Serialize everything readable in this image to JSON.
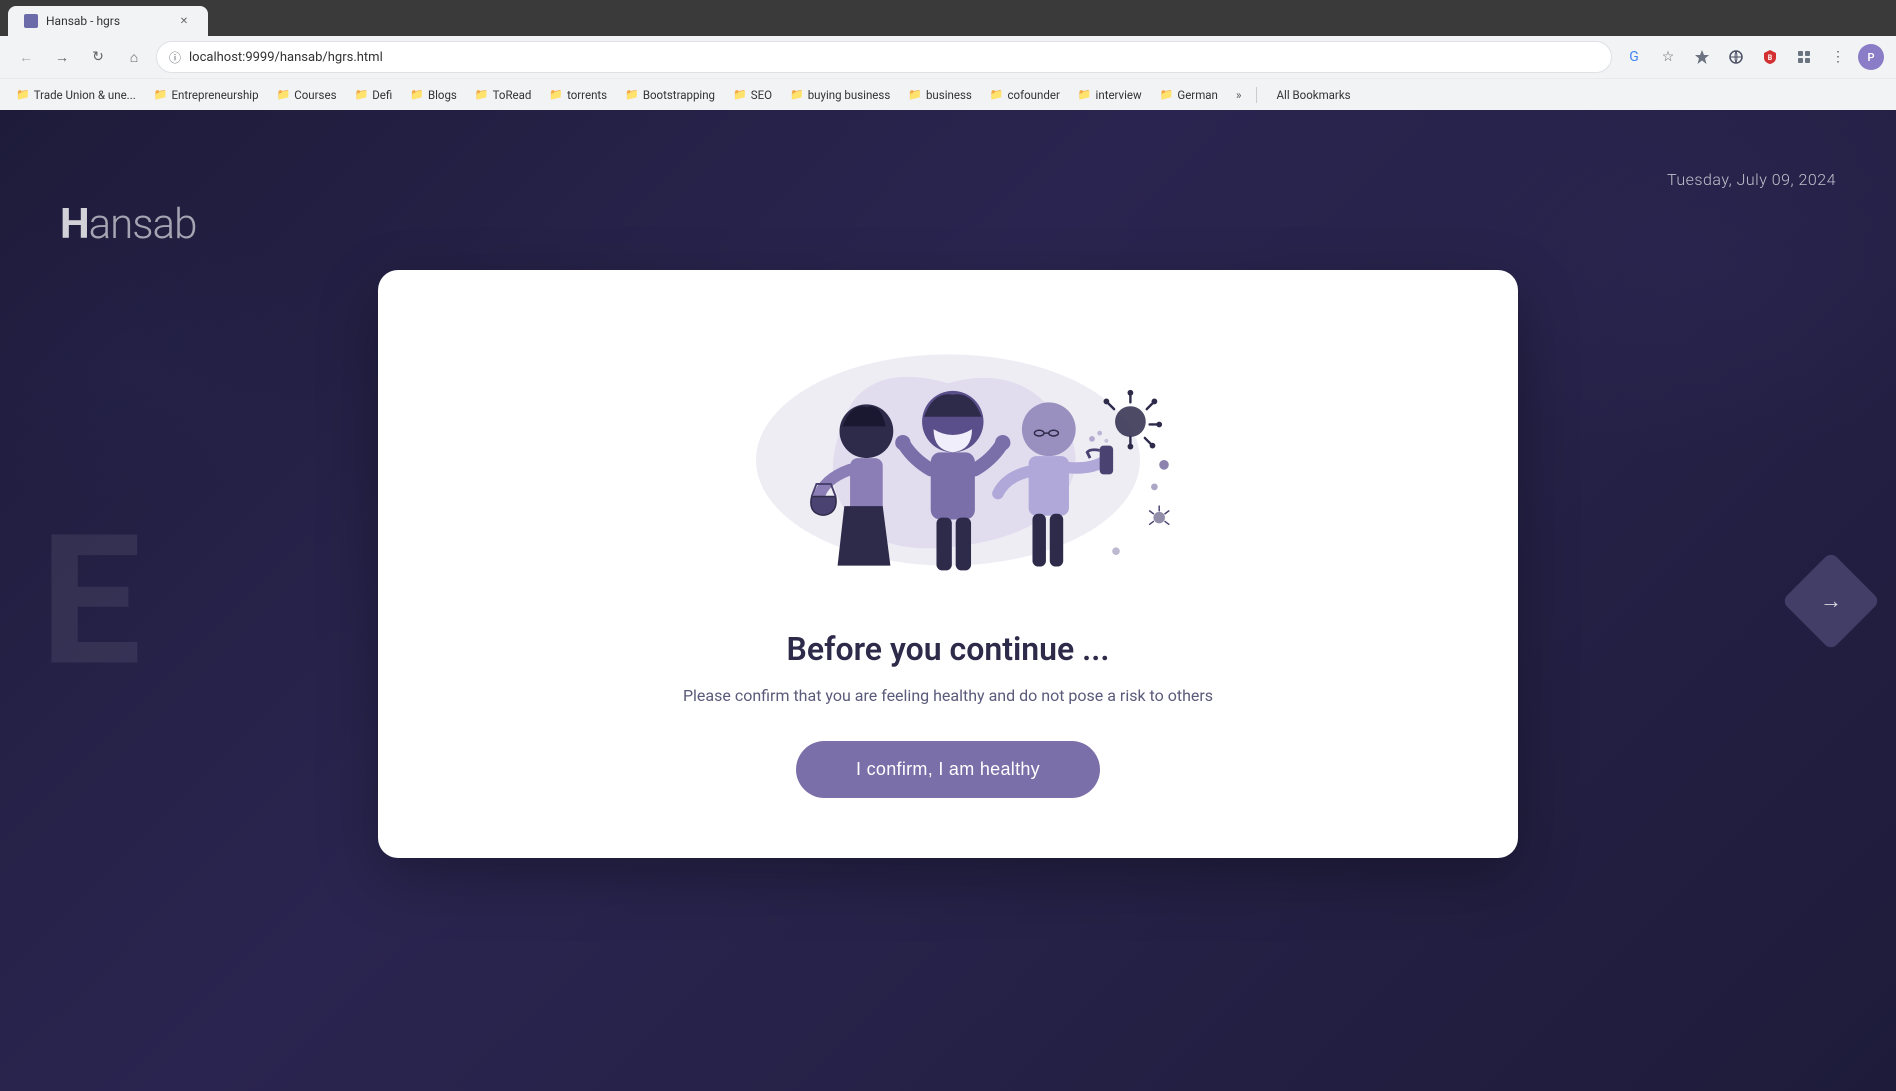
{
  "browser": {
    "tab_title": "Hansab - hgrs",
    "url": "localhost:9999/hansab/hgrs.html",
    "profile_initial": "P"
  },
  "bookmarks": [
    {
      "label": "Trade Union & une...",
      "id": "trade-union"
    },
    {
      "label": "Entrepreneurship",
      "id": "entrepreneurship"
    },
    {
      "label": "Courses",
      "id": "courses"
    },
    {
      "label": "Defi",
      "id": "defi"
    },
    {
      "label": "Blogs",
      "id": "blogs"
    },
    {
      "label": "ToRead",
      "id": "toread"
    },
    {
      "label": "torrents",
      "id": "torrents"
    },
    {
      "label": "Bootstrapping",
      "id": "bootstrapping"
    },
    {
      "label": "SEO",
      "id": "seo"
    },
    {
      "label": "buying business",
      "id": "buying-business"
    },
    {
      "label": "business",
      "id": "business"
    },
    {
      "label": "cofounder",
      "id": "cofounder"
    },
    {
      "label": "interview",
      "id": "interview"
    },
    {
      "label": "German",
      "id": "german"
    }
  ],
  "bookmarks_more_label": "»",
  "all_bookmarks_label": "All Bookmarks",
  "page": {
    "date": "Tuesday, July 09, 2024",
    "logo": "Hansab",
    "watermark_letter": "E",
    "card": {
      "title": "Before you continue ...",
      "subtitle": "Please confirm that you are feeling healthy and do not pose a risk to others",
      "button_label": "I confirm, I am healthy"
    }
  },
  "nav_arrow": "→"
}
